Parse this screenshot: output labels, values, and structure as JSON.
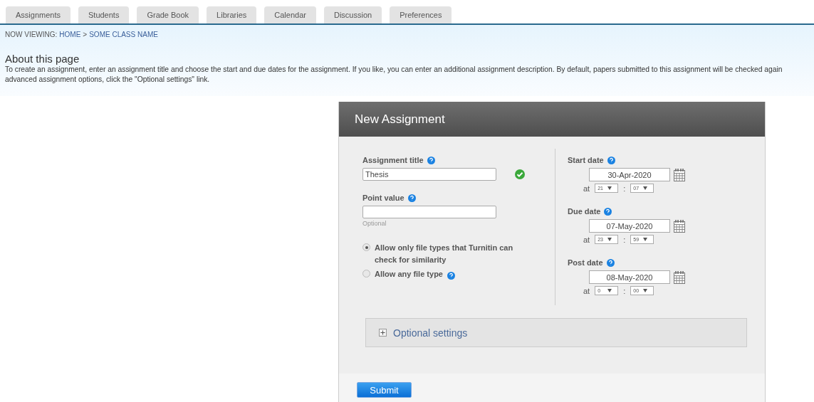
{
  "tabs": [
    "Assignments",
    "Students",
    "Grade Book",
    "Libraries",
    "Calendar",
    "Discussion",
    "Preferences"
  ],
  "breadcrumb": {
    "prefix": "NOW VIEWING:",
    "items": [
      "HOME",
      "SOME CLASS NAME"
    ],
    "separator": ">"
  },
  "about": {
    "title": "About this page",
    "lines": [
      "To create an assignment, enter an assignment title and choose the start and due dates for the assignment. If you like, you can enter an additional assignment description. By default, papers submitted to this assignment will be checked again",
      "advanced assignment options, click the \"Optional settings\" link."
    ]
  },
  "form": {
    "title": "New Assignment",
    "assignment_title": {
      "label": "Assignment title",
      "value": "Thesis",
      "valid": true
    },
    "point_value": {
      "label": "Point value",
      "hint": "Optional"
    },
    "file_types": [
      {
        "label": "Allow only file types that Turnitin can check for similarity",
        "selected": true,
        "help": false
      },
      {
        "label": "Allow any file type",
        "selected": false,
        "help": true
      }
    ],
    "dates": [
      {
        "label": "Start date",
        "date": "30-Apr-2020",
        "at": "at",
        "hour": "21",
        "separator": ":",
        "minute": "07"
      },
      {
        "label": "Due date",
        "date": "07-May-2020",
        "at": "at",
        "hour": "23",
        "separator": ":",
        "minute": "59"
      },
      {
        "label": "Post date",
        "date": "08-May-2020",
        "at": "at",
        "hour": "0",
        "separator": ":",
        "minute": "00"
      }
    ],
    "optional_settings": {
      "label": "Optional settings",
      "expanded": false
    },
    "submit": "Submit"
  }
}
